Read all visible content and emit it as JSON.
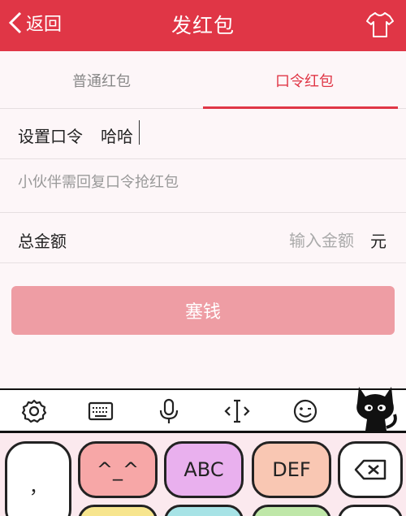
{
  "header": {
    "back_label": "返回",
    "title": "发红包",
    "accent_color": "#e03646",
    "right_icon": "tshirt-icon"
  },
  "tabs": [
    {
      "label": "普通红包",
      "active": false
    },
    {
      "label": "口令红包",
      "active": true
    }
  ],
  "form": {
    "password_label": "设置口令",
    "password_value": "哈哈",
    "hint_text": "小伙伴需回复口令抢红包",
    "amount_label": "总金额",
    "amount_placeholder": "输入金额",
    "amount_unit": "元",
    "submit_label": "塞钱"
  },
  "keyboard": {
    "toolbar_icons": [
      "settings-icon",
      "keyboard-icon",
      "microphone-icon",
      "cursor-move-icon",
      "emoji-icon"
    ],
    "keys_row1": {
      "punct": "，",
      "k1": "^_^",
      "k2": "ABC",
      "k3": "DEF",
      "delete": "delete-icon"
    }
  }
}
